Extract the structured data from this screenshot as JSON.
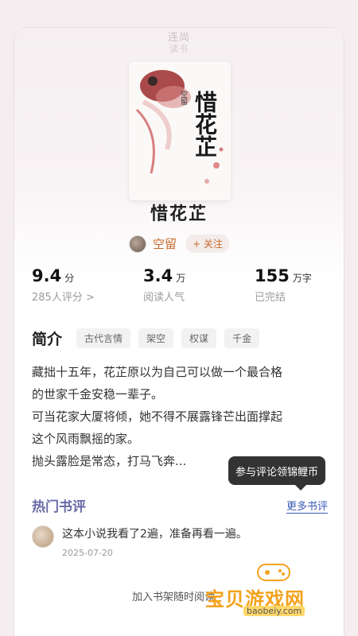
{
  "header": {
    "brand_line1": "连尚",
    "brand_line2": "读书"
  },
  "book": {
    "cover_title": "惜花芷",
    "cover_author_small": "空留",
    "title": "惜花芷"
  },
  "author": {
    "name": "空留",
    "follow_label": "+ 关注"
  },
  "stats": [
    {
      "value": "9.4",
      "unit": "分",
      "label": "285人评分 >"
    },
    {
      "value": "3.4",
      "unit": "万",
      "label": "阅读人气"
    },
    {
      "value": "155",
      "unit": "万字",
      "label": "已完结"
    }
  ],
  "intro": {
    "title": "简介",
    "tags": [
      "古代言情",
      "架空",
      "权谋",
      "千金"
    ],
    "lines": [
      "藏拙十五年，花芷原以为自己可以做一个最合格",
      "的世家千金安稳一辈子。",
      "可当花家大厦将倾，她不得不展露锋芒出面撑起",
      "这个风雨飘摇的家。",
      "抛头露脸是常态，打马飞奔..."
    ]
  },
  "tooltip": {
    "text": "参与评论领锦鲤币"
  },
  "hot_reviews": {
    "title": "热门书评",
    "more_label": "更多书评",
    "items": [
      {
        "text": "这本小说我看了2遍，准备再看一遍。",
        "date": "2025-07-20"
      }
    ]
  },
  "footer": {
    "shelf_link": "加入书架随时阅读"
  },
  "watermark": {
    "text": "宝贝游戏网",
    "url": "baobeiy.com"
  },
  "colors": {
    "accent": "#c8692a",
    "link": "#3a5ab8",
    "section_title": "#6a6aa8"
  }
}
